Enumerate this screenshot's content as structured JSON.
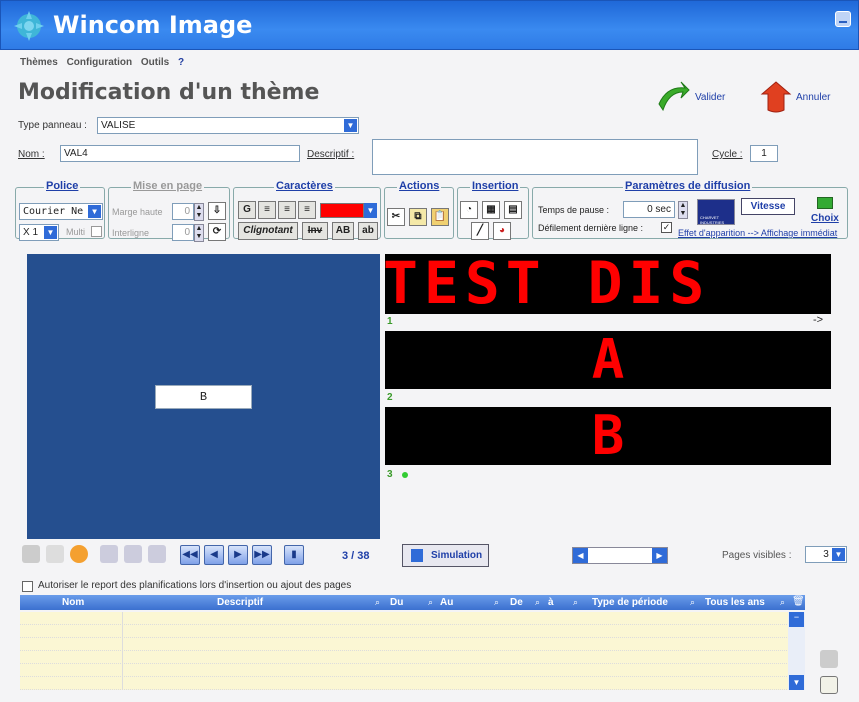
{
  "window": {
    "title": "Wincom Image"
  },
  "menu": [
    "Thèmes",
    "Configuration",
    "Outils",
    "?"
  ],
  "page_title": "Modification d'un thème",
  "actions": {
    "validate_label": "Valider",
    "cancel_label": "Annuler"
  },
  "type_panneau": {
    "label": "Type panneau :",
    "value": "VALISE"
  },
  "nom": {
    "label": "Nom :",
    "value": "VAL4"
  },
  "descriptif": {
    "label": "Descriptif :",
    "value": ""
  },
  "cycle": {
    "label": "Cycle :",
    "value": "1"
  },
  "police": {
    "title": "Police",
    "font": "Courier Ne",
    "size": "X 1",
    "multi_label": "Multi"
  },
  "mise_en_page": {
    "title": "Mise en page",
    "marge_label": "Marge haute",
    "marge_value": "0",
    "interligne_label": "Interligne",
    "interligne_value": "0"
  },
  "caracteres": {
    "title": "Caractères",
    "bold": "G",
    "blink": "Clignotant",
    "inv": "Inv",
    "upper": "AB",
    "lower": "ab",
    "color": "#ff0000"
  },
  "actions_group": {
    "title": "Actions"
  },
  "insertion": {
    "title": "Insertion"
  },
  "diffusion": {
    "title": "Paramètres de diffusion",
    "pause_label": "Temps de pause :",
    "pause_value": "0 sec",
    "defilement_label": "Défilement dernière ligne :",
    "vitesse_label": "Vitesse",
    "choix_label": "Choix",
    "effet_label": "Effet d'apparition --> Affichage immédiat",
    "logo_text": "CHARVET INDUSTRIES"
  },
  "editor": {
    "text": "B"
  },
  "display_lines": [
    {
      "num": "1",
      "text": "TEST DIS"
    },
    {
      "num": "2",
      "text": "A"
    },
    {
      "num": "3",
      "text": "B"
    }
  ],
  "scroll_arrow": "->",
  "pager": {
    "text": "3 / 38",
    "simulation_label": "Simulation",
    "pages_visibles_label": "Pages visibles :",
    "pages_visibles_value": "3"
  },
  "report_checkbox_label": "Autoriser le report des planifications lors d'insertion ou ajout des pages",
  "table": {
    "columns": [
      "Nom",
      "Descriptif",
      "Du",
      "Au",
      "De",
      "à",
      "Type de période",
      "Tous les ans"
    ]
  },
  "colors": {
    "title_blue": "#2f7be6",
    "led_red": "#ff0000",
    "editor_blue": "#254f8f"
  }
}
